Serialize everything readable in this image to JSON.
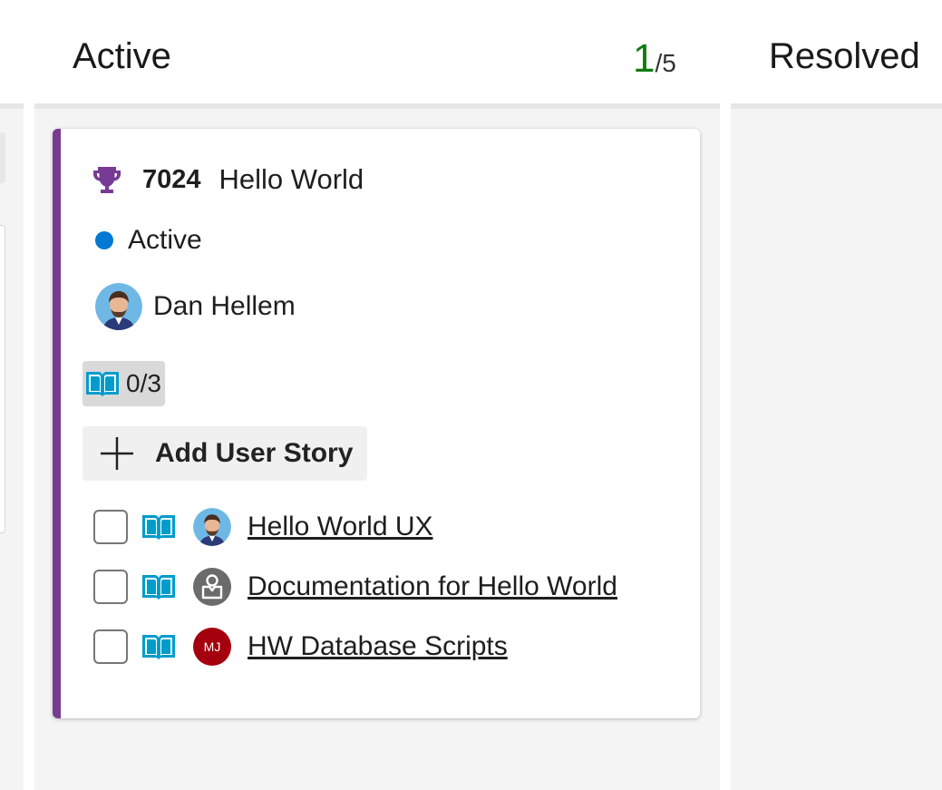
{
  "columns": {
    "active": {
      "title": "Active",
      "count": "1",
      "limit": "/5"
    },
    "resolved": {
      "title": "Resolved"
    }
  },
  "card": {
    "id": "7024",
    "title": "Hello World",
    "type_icon": "trophy-icon",
    "type_color": "#773b93",
    "state": "Active",
    "state_color": "#0078d4",
    "assigned_to": "Dan Hellem",
    "child_progress": "0/3",
    "add_button_label": "Add User Story",
    "children": [
      {
        "title": "Hello World UX",
        "assignee_avatar": "dan-avatar"
      },
      {
        "title": "Documentation for Hello World",
        "assignee_avatar": "unassigned-avatar"
      },
      {
        "title": "HW Database Scripts",
        "assignee_avatar": "initials-avatar",
        "initials": "MJ"
      }
    ]
  },
  "colors": {
    "count_accent": "#107c10",
    "story_icon": "#009ccc",
    "initials_bg": "#a4000d"
  }
}
